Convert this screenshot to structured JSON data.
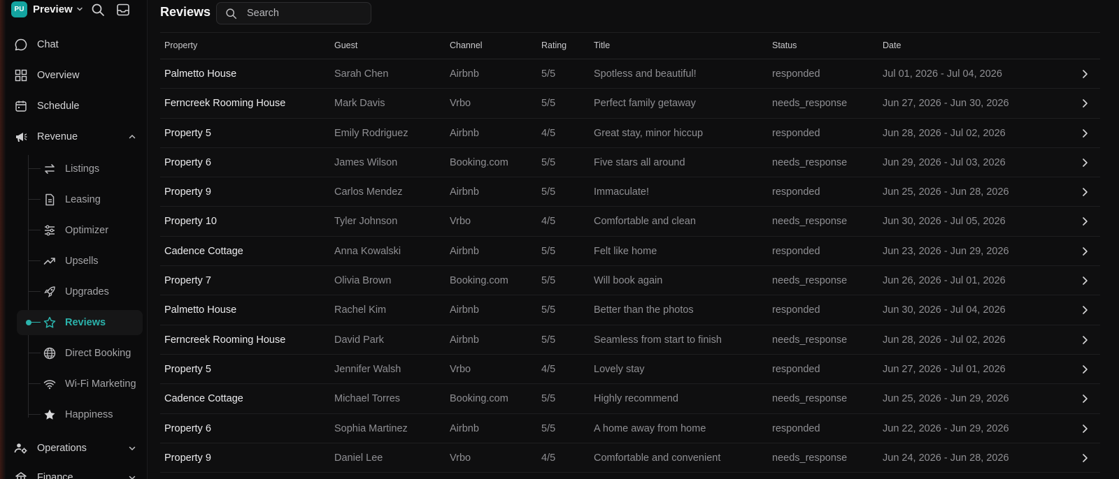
{
  "workspace": {
    "initials": "PU",
    "name": "Preview"
  },
  "sidebar": {
    "items": [
      {
        "label": "Chat",
        "icon": "chat-icon"
      },
      {
        "label": "Overview",
        "icon": "grid-icon"
      },
      {
        "label": "Schedule",
        "icon": "calendar-icon"
      },
      {
        "label": "Revenue",
        "icon": "megaphone-icon"
      }
    ],
    "revenue_children": [
      {
        "label": "Listings",
        "icon": "swap-icon"
      },
      {
        "label": "Leasing",
        "icon": "document-icon"
      },
      {
        "label": "Optimizer",
        "icon": "sliders-icon"
      },
      {
        "label": "Upsells",
        "icon": "trend-up-icon"
      },
      {
        "label": "Upgrades",
        "icon": "rocket-icon"
      },
      {
        "label": "Reviews",
        "icon": "star-outline-icon"
      },
      {
        "label": "Direct Booking",
        "icon": "globe-icon"
      },
      {
        "label": "Wi-Fi Marketing",
        "icon": "wifi-icon"
      },
      {
        "label": "Happiness",
        "icon": "star-filled-icon"
      }
    ],
    "bottom_items": [
      {
        "label": "Operations",
        "icon": "people-gear-icon"
      },
      {
        "label": "Finance",
        "icon": "finance-icon"
      }
    ]
  },
  "header": {
    "title": "Reviews",
    "search_placeholder": "Search"
  },
  "table": {
    "columns": [
      "Property",
      "Guest",
      "Channel",
      "Rating",
      "Title",
      "Status",
      "Date"
    ],
    "rows": [
      [
        "Palmetto House",
        "Sarah Chen",
        "Airbnb",
        "5/5",
        "Spotless and beautiful!",
        "responded",
        "Jul 01, 2026 - Jul 04, 2026"
      ],
      [
        "Ferncreek Rooming House",
        "Mark Davis",
        "Vrbo",
        "5/5",
        "Perfect family getaway",
        "needs_response",
        "Jun 27, 2026 - Jun 30, 2026"
      ],
      [
        "Property 5",
        "Emily Rodriguez",
        "Airbnb",
        "4/5",
        "Great stay, minor hiccup",
        "responded",
        "Jun 28, 2026 - Jul 02, 2026"
      ],
      [
        "Property 6",
        "James Wilson",
        "Booking.com",
        "5/5",
        "Five stars all around",
        "needs_response",
        "Jun 29, 2026 - Jul 03, 2026"
      ],
      [
        "Property 9",
        "Carlos Mendez",
        "Airbnb",
        "5/5",
        "Immaculate!",
        "responded",
        "Jun 25, 2026 - Jun 28, 2026"
      ],
      [
        "Property 10",
        "Tyler Johnson",
        "Vrbo",
        "4/5",
        "Comfortable and clean",
        "needs_response",
        "Jun 30, 2026 - Jul 05, 2026"
      ],
      [
        "Cadence Cottage",
        "Anna Kowalski",
        "Airbnb",
        "5/5",
        "Felt like home",
        "responded",
        "Jun 23, 2026 - Jun 29, 2026"
      ],
      [
        "Property 7",
        "Olivia Brown",
        "Booking.com",
        "5/5",
        "Will book again",
        "needs_response",
        "Jun 26, 2026 - Jul 01, 2026"
      ],
      [
        "Palmetto House",
        "Rachel Kim",
        "Airbnb",
        "5/5",
        "Better than the photos",
        "responded",
        "Jun 30, 2026 - Jul 04, 2026"
      ],
      [
        "Ferncreek Rooming House",
        "David Park",
        "Airbnb",
        "5/5",
        "Seamless from start to finish",
        "needs_response",
        "Jun 28, 2026 - Jul 02, 2026"
      ],
      [
        "Property 5",
        "Jennifer Walsh",
        "Vrbo",
        "4/5",
        "Lovely stay",
        "responded",
        "Jun 27, 2026 - Jul 01, 2026"
      ],
      [
        "Cadence Cottage",
        "Michael Torres",
        "Booking.com",
        "5/5",
        "Highly recommend",
        "needs_response",
        "Jun 25, 2026 - Jun 29, 2026"
      ],
      [
        "Property 6",
        "Sophia Martinez",
        "Airbnb",
        "5/5",
        "A home away from home",
        "responded",
        "Jun 22, 2026 - Jun 29, 2026"
      ],
      [
        "Property 9",
        "Daniel Lee",
        "Vrbo",
        "4/5",
        "Comfortable and convenient",
        "needs_response",
        "Jun 24, 2026 - Jun 28, 2026"
      ]
    ]
  },
  "colors": {
    "accent": "#2bb3ac",
    "badge": "#14a4a0",
    "background": "#0e0e0f"
  }
}
